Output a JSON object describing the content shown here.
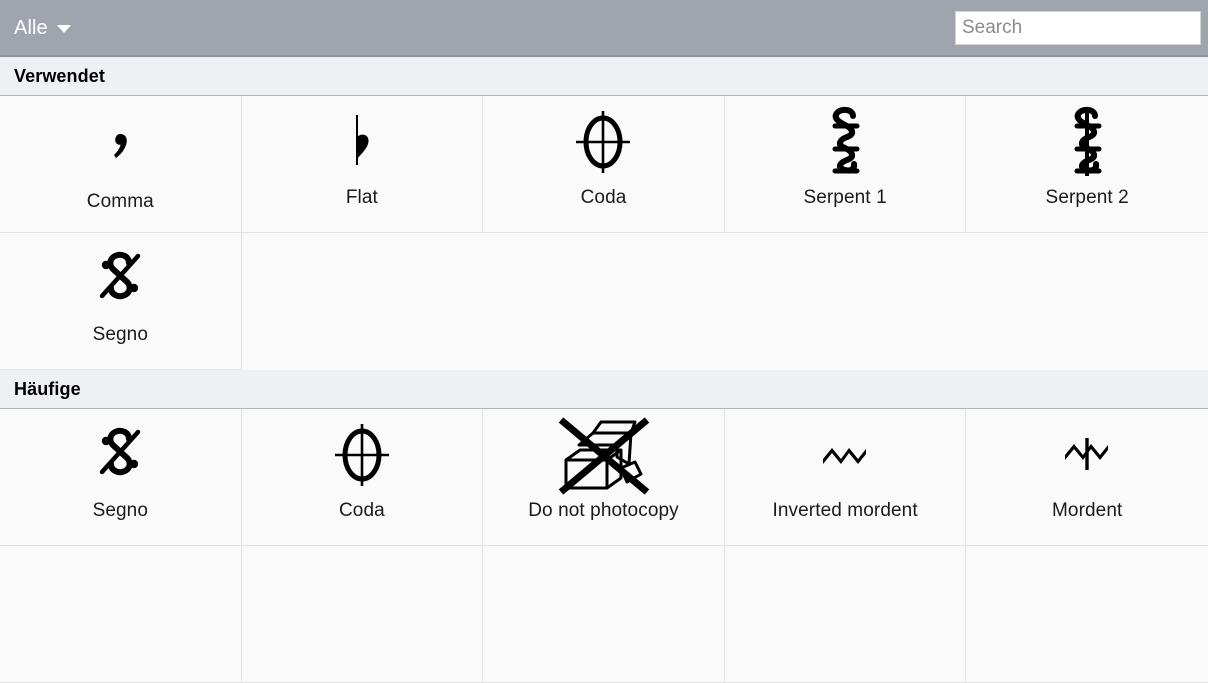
{
  "toolbar": {
    "filter_label": "Alle",
    "filter_icon": "chevron-down-icon",
    "search_placeholder": "Search",
    "search_value": "",
    "background_color": "#a0a5ad"
  },
  "sections": [
    {
      "title": "Verwendet",
      "items": [
        {
          "label": "Comma",
          "icon": "comma-breath-mark-icon"
        },
        {
          "label": "Flat",
          "icon": "flat-icon"
        },
        {
          "label": "Coda",
          "icon": "coda-icon"
        },
        {
          "label": "Serpent 1",
          "icon": "serpent-1-icon"
        },
        {
          "label": "Serpent 2",
          "icon": "serpent-2-icon"
        },
        {
          "label": "Segno",
          "icon": "segno-icon"
        }
      ]
    },
    {
      "title": "Häufige",
      "items": [
        {
          "label": "Segno",
          "icon": "segno-icon"
        },
        {
          "label": "Coda",
          "icon": "coda-icon"
        },
        {
          "label": "Do not photocopy",
          "icon": "do-not-photocopy-icon"
        },
        {
          "label": "Inverted mordent",
          "icon": "inverted-mordent-icon"
        },
        {
          "label": "Mordent",
          "icon": "mordent-icon"
        }
      ]
    }
  ],
  "colors": {
    "toolbar": "#a0a5ad",
    "section_header": "#eff0f4",
    "cell_background": "#fafafa",
    "grid_line": "#e2e2e2",
    "text": "#1a1a1a"
  }
}
